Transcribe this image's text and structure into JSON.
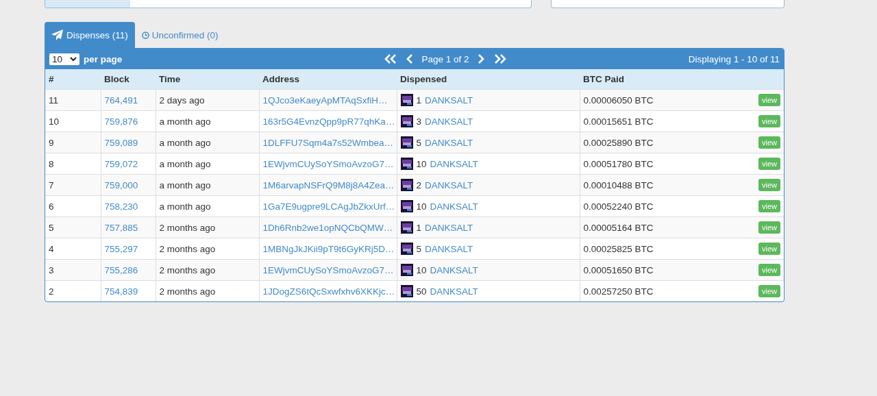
{
  "tabs": [
    {
      "label": "Dispenses (11)",
      "kind": "sent",
      "selected": true
    },
    {
      "label": "Unconfirmed (0)",
      "kind": "pending",
      "selected": false
    }
  ],
  "pager": {
    "per_page": "10",
    "per_page_label": "per page",
    "page": "Page 1 of 2",
    "displaying": "Displaying 1 - 10 of 11"
  },
  "table": {
    "columns": [
      "#",
      "Block",
      "Time",
      "Address",
      "Dispensed",
      "BTC Paid"
    ],
    "rows": [
      {
        "index": "11",
        "block": "764,491",
        "time": "2 days ago",
        "address": "1QJco3eKaeyApMTAqSxfiH…",
        "amount": "1",
        "asset": "DANKSALT",
        "paid": "0.00006050 BTC",
        "action": "view"
      },
      {
        "index": "10",
        "block": "759,876",
        "time": "a month ago",
        "address": "163r5G4EvnzQpp9pR77qhKa…",
        "amount": "3",
        "asset": "DANKSALT",
        "paid": "0.00015651 BTC",
        "action": "view"
      },
      {
        "index": "9",
        "block": "759,089",
        "time": "a month ago",
        "address": "1DLFFU7Sqm4a7s52Wmbea…",
        "amount": "5",
        "asset": "DANKSALT",
        "paid": "0.00025890 BTC",
        "action": "view"
      },
      {
        "index": "8",
        "block": "759,072",
        "time": "a month ago",
        "address": "1EWjvmCUySoYSmoAvzoG7…",
        "amount": "10",
        "asset": "DANKSALT",
        "paid": "0.00051780 BTC",
        "action": "view"
      },
      {
        "index": "7",
        "block": "759,000",
        "time": "a month ago",
        "address": "1M6arvapNSFrQ9M8j8A4Zea…",
        "amount": "2",
        "asset": "DANKSALT",
        "paid": "0.00010488 BTC",
        "action": "view"
      },
      {
        "index": "6",
        "block": "758,230",
        "time": "a month ago",
        "address": "1Ga7E9ugpre9LCAgJbZkxUrf…",
        "amount": "10",
        "asset": "DANKSALT",
        "paid": "0.00052240 BTC",
        "action": "view"
      },
      {
        "index": "5",
        "block": "757,885",
        "time": "2 months ago",
        "address": "1Dh6Rnb2we1opNQCbQMW…",
        "amount": "1",
        "asset": "DANKSALT",
        "paid": "0.00005164 BTC",
        "action": "view"
      },
      {
        "index": "4",
        "block": "755,297",
        "time": "2 months ago",
        "address": "1MBNgJkJKii9pT9t6GyKRj5D…",
        "amount": "5",
        "asset": "DANKSALT",
        "paid": "0.00025825 BTC",
        "action": "view"
      },
      {
        "index": "3",
        "block": "755,286",
        "time": "2 months ago",
        "address": "1EWjvmCUySoYSmoAvzoG7…",
        "amount": "10",
        "asset": "DANKSALT",
        "paid": "0.00051650 BTC",
        "action": "view"
      },
      {
        "index": "2",
        "block": "754,839",
        "time": "2 months ago",
        "address": "1JDogZS6tQcSxwfxhv6XKKjc…",
        "amount": "50",
        "asset": "DANKSALT",
        "paid": "0.00257250 BTC",
        "action": "view"
      }
    ]
  }
}
